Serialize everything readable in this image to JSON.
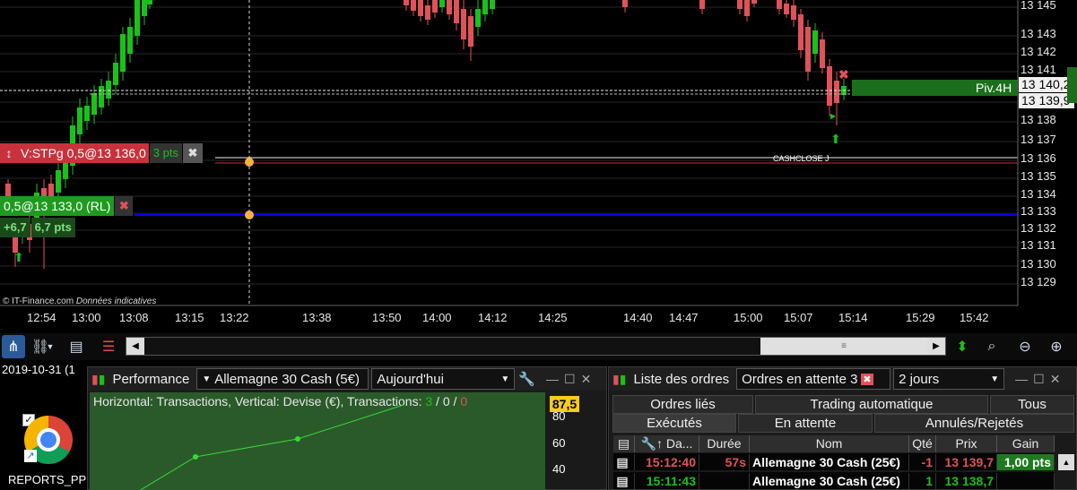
{
  "chart": {
    "watermark_brand": "© IT-Finance.com",
    "watermark_note": "Données indicatives",
    "price_labels": [
      "13 145",
      "13 143",
      "13 142",
      "13 141",
      "13 139",
      "13 138",
      "13 137",
      "13 136",
      "13 135",
      "13 134",
      "13 133",
      "13 132",
      "13 131",
      "13 130",
      "13 129"
    ],
    "price_badge_pivot": "13 140,2",
    "price_badge_current": "13 139,9",
    "pivot_label": "Piv.4H",
    "cashclose_label": "CASHCLOSE J",
    "time_labels": [
      "12:54",
      "13:00",
      "13:08",
      "13:15",
      "13:22",
      "13:38",
      "13:50",
      "14:00",
      "14:12",
      "14:25",
      "14:40",
      "14:47",
      "15:00",
      "15:07",
      "15:14",
      "15:29",
      "15:42"
    ],
    "stop_order": {
      "label": "V:STPg 0,5@13 136,0",
      "pts": "3 pts"
    },
    "limit_order": {
      "label": "0,5@13 133,0 (RL)"
    },
    "position": {
      "gain": "+6,7",
      "pts": "6,7 pts"
    },
    "colors": {
      "bull": "#19c219",
      "bear": "#e0525a",
      "stop": "#c8323c",
      "limit": "#1f9a1f",
      "blue_line": "#0000ff"
    }
  },
  "desktop": {
    "date_text": "2019-10-31 (1",
    "icon_label": "REPORTS_PP"
  },
  "performance": {
    "title": "Performance",
    "instrument": "Allemagne 30 Cash (5€)",
    "period": "Aujourd'hui",
    "subtitle_prefix": "Horizontal: Transactions, Vertical: Devise (€), Transactions:",
    "tx_win": "3",
    "tx_sep1": " / ",
    "tx_mid": "0",
    "tx_sep2": " / ",
    "tx_loss": "0",
    "value_badge": "87,5",
    "y_labels": [
      "80",
      "60",
      "40"
    ]
  },
  "orders": {
    "title": "Liste des ordres",
    "filter": "Ordres en attente 3",
    "period": "2 jours",
    "tabs_row1": [
      "Ordres liés",
      "Trading automatique",
      "Tous"
    ],
    "tabs_row2": [
      "Exécutés",
      "En attente",
      "Annulés/Rejetés"
    ],
    "columns": [
      "Da...",
      "Durée",
      "Nom",
      "Qté",
      "Prix",
      "Gain"
    ],
    "rows": [
      {
        "time": "15:12:40",
        "duration": "57s",
        "name": "Allemagne 30 Cash (25€)",
        "qty": "-1",
        "price": "13 139,7",
        "gain": "1,00 pts"
      },
      {
        "time": "15:11:43",
        "duration": "",
        "name": "Allemagne 30 Cash (25€)",
        "qty": "1",
        "price": "13 138,7",
        "gain": ""
      }
    ]
  }
}
